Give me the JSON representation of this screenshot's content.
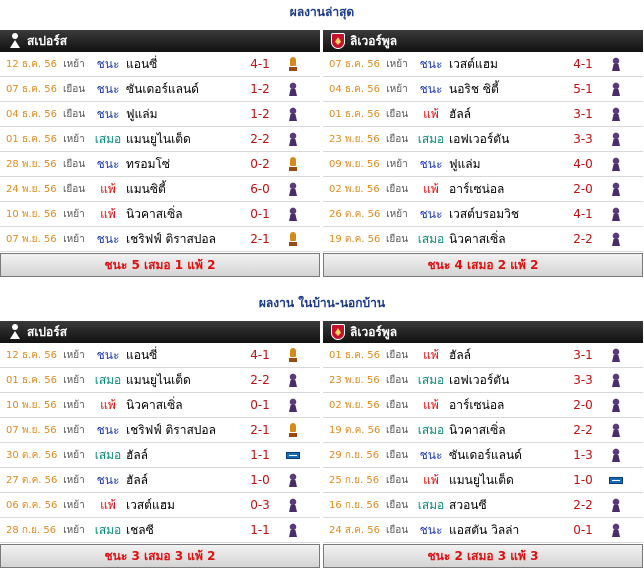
{
  "sections": [
    {
      "title": "ผลงานล่าสุด",
      "left": {
        "team": "สเปอร์ส",
        "crest": "spurs-crest-icon",
        "matches": [
          {
            "date": "12 ธ.ค. 56",
            "venue": "เหย้า",
            "result": "ชนะ",
            "type": "win",
            "opponent": "แอนซี่",
            "score": "4-1",
            "comp": "europa-league-icon"
          },
          {
            "date": "07 ธ.ค. 56",
            "venue": "เยือน",
            "result": "ชนะ",
            "type": "win",
            "opponent": "ซันเดอร์แลนด์",
            "score": "1-2",
            "comp": "premier-league-icon"
          },
          {
            "date": "04 ธ.ค. 56",
            "venue": "เยือน",
            "result": "ชนะ",
            "type": "win",
            "opponent": "ฟูแล่ม",
            "score": "1-2",
            "comp": "premier-league-icon"
          },
          {
            "date": "01 ธ.ค. 56",
            "venue": "เหย้า",
            "result": "เสมอ",
            "type": "draw",
            "opponent": "แมนยูไนเต็ด",
            "score": "2-2",
            "comp": "premier-league-icon"
          },
          {
            "date": "28 พ.ย. 56",
            "venue": "เยือน",
            "result": "ชนะ",
            "type": "win",
            "opponent": "ทรอมโซ่",
            "score": "0-2",
            "comp": "europa-league-icon"
          },
          {
            "date": "24 พ.ย. 56",
            "venue": "เยือน",
            "result": "แพ้",
            "type": "loss",
            "opponent": "แมนซิตี้",
            "score": "6-0",
            "comp": "premier-league-icon"
          },
          {
            "date": "10 พ.ย. 56",
            "venue": "เหย้า",
            "result": "แพ้",
            "type": "loss",
            "opponent": "นิวคาสเซิ่ล",
            "score": "0-1",
            "comp": "premier-league-icon"
          },
          {
            "date": "07 พ.ย. 56",
            "venue": "เหย้า",
            "result": "ชนะ",
            "type": "win",
            "opponent": "เชริฟฟ์ ติราสปอล",
            "score": "2-1",
            "comp": "europa-league-icon"
          }
        ],
        "summary": "ชนะ 5 เสมอ 1 แพ้ 2"
      },
      "right": {
        "team": "ลิเวอร์พูล",
        "crest": "liverpool-crest-icon",
        "matches": [
          {
            "date": "07 ธ.ค. 56",
            "venue": "เหย้า",
            "result": "ชนะ",
            "type": "win",
            "opponent": "เวสต์แฮม",
            "score": "4-1",
            "comp": "premier-league-icon"
          },
          {
            "date": "04 ธ.ค. 56",
            "venue": "เหย้า",
            "result": "ชนะ",
            "type": "win",
            "opponent": "นอริช ซิตี้",
            "score": "5-1",
            "comp": "premier-league-icon"
          },
          {
            "date": "01 ธ.ค. 56",
            "venue": "เยือน",
            "result": "แพ้",
            "type": "loss",
            "opponent": "ฮัลล์",
            "score": "3-1",
            "comp": "premier-league-icon"
          },
          {
            "date": "23 พ.ย. 56",
            "venue": "เยือน",
            "result": "เสมอ",
            "type": "draw",
            "opponent": "เอฟเวอร์ตัน",
            "score": "3-3",
            "comp": "premier-league-icon"
          },
          {
            "date": "09 พ.ย. 56",
            "venue": "เหย้า",
            "result": "ชนะ",
            "type": "win",
            "opponent": "ฟูแล่ม",
            "score": "4-0",
            "comp": "premier-league-icon"
          },
          {
            "date": "02 พ.ย. 56",
            "venue": "เยือน",
            "result": "แพ้",
            "type": "loss",
            "opponent": "อาร์เซน่อล",
            "score": "2-0",
            "comp": "premier-league-icon"
          },
          {
            "date": "26 ต.ค. 56",
            "venue": "เหย้า",
            "result": "ชนะ",
            "type": "win",
            "opponent": "เวสต์บรอมวิช",
            "score": "4-1",
            "comp": "premier-league-icon"
          },
          {
            "date": "19 ต.ค. 56",
            "venue": "เยือน",
            "result": "เสมอ",
            "type": "draw",
            "opponent": "นิวคาสเซิ่ล",
            "score": "2-2",
            "comp": "premier-league-icon"
          }
        ],
        "summary": "ชนะ 4 เสมอ 2 แพ้ 2"
      }
    },
    {
      "title": "ผลงาน ในบ้าน-นอกบ้าน",
      "left": {
        "team": "สเปอร์ส",
        "crest": "spurs-crest-icon",
        "matches": [
          {
            "date": "12 ธ.ค. 56",
            "venue": "เหย้า",
            "result": "ชนะ",
            "type": "win",
            "opponent": "แอนซี่",
            "score": "4-1",
            "comp": "europa-league-icon"
          },
          {
            "date": "01 ธ.ค. 56",
            "venue": "เหย้า",
            "result": "เสมอ",
            "type": "draw",
            "opponent": "แมนยูไนเต็ด",
            "score": "2-2",
            "comp": "premier-league-icon"
          },
          {
            "date": "10 พ.ย. 56",
            "venue": "เหย้า",
            "result": "แพ้",
            "type": "loss",
            "opponent": "นิวคาสเซิ่ล",
            "score": "0-1",
            "comp": "premier-league-icon"
          },
          {
            "date": "07 พ.ย. 56",
            "venue": "เหย้า",
            "result": "ชนะ",
            "type": "win",
            "opponent": "เชริฟฟ์ ติราสปอล",
            "score": "2-1",
            "comp": "europa-league-icon"
          },
          {
            "date": "30 ต.ค. 56",
            "venue": "เหย้า",
            "result": "เสมอ",
            "type": "draw",
            "opponent": "ฮัลล์",
            "score": "1-1",
            "comp": "league-cup-icon"
          },
          {
            "date": "27 ต.ค. 56",
            "venue": "เหย้า",
            "result": "ชนะ",
            "type": "win",
            "opponent": "ฮัลล์",
            "score": "1-0",
            "comp": "premier-league-icon"
          },
          {
            "date": "06 ต.ค. 56",
            "venue": "เหย้า",
            "result": "แพ้",
            "type": "loss",
            "opponent": "เวสต์แฮม",
            "score": "0-3",
            "comp": "premier-league-icon"
          },
          {
            "date": "28 ก.ย. 56",
            "venue": "เหย้า",
            "result": "เสมอ",
            "type": "draw",
            "opponent": "เชลซี",
            "score": "1-1",
            "comp": "premier-league-icon"
          }
        ],
        "summary": "ชนะ 3 เสมอ 3 แพ้ 2"
      },
      "right": {
        "team": "ลิเวอร์พูล",
        "crest": "liverpool-crest-icon",
        "matches": [
          {
            "date": "01 ธ.ค. 56",
            "venue": "เยือน",
            "result": "แพ้",
            "type": "loss",
            "opponent": "ฮัลล์",
            "score": "3-1",
            "comp": "premier-league-icon"
          },
          {
            "date": "23 พ.ย. 56",
            "venue": "เยือน",
            "result": "เสมอ",
            "type": "draw",
            "opponent": "เอฟเวอร์ตัน",
            "score": "3-3",
            "comp": "premier-league-icon"
          },
          {
            "date": "02 พ.ย. 56",
            "venue": "เยือน",
            "result": "แพ้",
            "type": "loss",
            "opponent": "อาร์เซน่อล",
            "score": "2-0",
            "comp": "premier-league-icon"
          },
          {
            "date": "19 ต.ค. 56",
            "venue": "เยือน",
            "result": "เสมอ",
            "type": "draw",
            "opponent": "นิวคาสเซิ่ล",
            "score": "2-2",
            "comp": "premier-league-icon"
          },
          {
            "date": "29 ก.ย. 56",
            "venue": "เยือน",
            "result": "ชนะ",
            "type": "win",
            "opponent": "ซันเดอร์แลนด์",
            "score": "1-3",
            "comp": "premier-league-icon"
          },
          {
            "date": "25 ก.ย. 56",
            "venue": "เยือน",
            "result": "แพ้",
            "type": "loss",
            "opponent": "แมนยูไนเต็ด",
            "score": "1-0",
            "comp": "league-cup-icon"
          },
          {
            "date": "16 ก.ย. 56",
            "venue": "เยือน",
            "result": "เสมอ",
            "type": "draw",
            "opponent": "สวอนซี",
            "score": "2-2",
            "comp": "premier-league-icon"
          },
          {
            "date": "24 ส.ค. 56",
            "venue": "เยือน",
            "result": "ชนะ",
            "type": "win",
            "opponent": "แอสตัน วิลล่า",
            "score": "0-1",
            "comp": "premier-league-icon"
          }
        ],
        "summary": "ชนะ 2 เสมอ 3 แพ้ 3"
      }
    }
  ]
}
